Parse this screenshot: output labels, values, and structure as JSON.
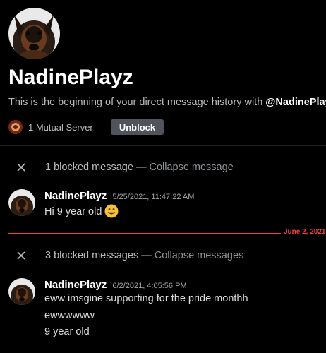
{
  "header": {
    "username": "NadinePlayz",
    "intro_prefix": "This is the beginning of your direct message history with ",
    "intro_mention": "@NadinePlayz",
    "intro_suffix": ".",
    "mutual_servers": "1 Mutual Server",
    "unblock_label": "Unblock"
  },
  "blocked_groups": [
    {
      "text": "1 blocked message — ",
      "action": "Collapse message"
    },
    {
      "text": "3 blocked messages — ",
      "action": "Collapse messages"
    }
  ],
  "messages": [
    {
      "author": "NadinePlayz",
      "timestamp": "5/25/2021, 11:47:22 AM",
      "lines": [
        "Hi 9 year old"
      ],
      "emoji": "grinning-face"
    },
    {
      "author": "NadinePlayz",
      "timestamp": "6/2/2021, 4:05:56 PM",
      "lines": [
        "eww imsgine supporting for the pride monthh",
        "ewwwwww",
        "9 year old"
      ]
    }
  ],
  "date_divider": "June 2, 2021",
  "colors": {
    "background": "#000000",
    "button": "#4f545c",
    "divider_red": "#ed4245",
    "emoji_yellow": "#f8c230"
  }
}
